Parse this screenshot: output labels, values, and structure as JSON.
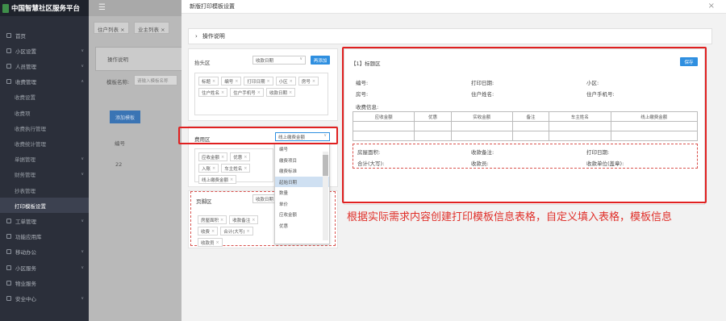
{
  "sidebar": {
    "title": "中国智慧社区服务平台",
    "items": [
      {
        "label": "首页",
        "icon": "home-icon",
        "chevron": ""
      },
      {
        "label": "小区设置",
        "icon": "building-icon",
        "chevron": "∨"
      },
      {
        "label": "人员管理",
        "icon": "users-icon",
        "chevron": "∨"
      },
      {
        "label": "收费管理",
        "icon": "money-icon",
        "chevron": "∧"
      },
      {
        "label": "收费设置",
        "sub": true
      },
      {
        "label": "收费项",
        "sub": true
      },
      {
        "label": "收费执行管理",
        "sub": true
      },
      {
        "label": "收费统计管理",
        "sub": true
      },
      {
        "label": "单据管理",
        "sub": true,
        "chevron": "∨"
      },
      {
        "label": "财务管理",
        "sub": true,
        "chevron": "∨"
      },
      {
        "label": "抄表管理",
        "sub": true
      },
      {
        "label": "打印模板设置",
        "sub": true,
        "active": true
      },
      {
        "label": "工单管理",
        "icon": "ticket-icon",
        "chevron": "∨"
      },
      {
        "label": "功能应用库",
        "icon": "grid-icon",
        "chevron": ""
      },
      {
        "label": "移动办公",
        "icon": "mobile-icon",
        "chevron": "∨"
      },
      {
        "label": "小区服务",
        "icon": "service-icon",
        "chevron": "∨"
      },
      {
        "label": "物业服务",
        "icon": "house-icon",
        "chevron": ""
      },
      {
        "label": "安全中心",
        "icon": "shield-icon",
        "chevron": "∨"
      }
    ]
  },
  "page": {
    "menu_glyph": "☰",
    "tabs": [
      "住户列表 ×",
      "业主列表 ×"
    ],
    "op_label": "操作说明",
    "search_label": "模板名称:",
    "search_placeholder": "请输入模板名称",
    "add_button": "添加模板",
    "col_header": "编号",
    "row_value": "22"
  },
  "modal": {
    "title": "新版打印模板设置",
    "close": "×",
    "op_row": "操作说明",
    "head_zone": {
      "label": "抬头区",
      "select": "收款日期",
      "button": "再添加",
      "tags": [
        "标题",
        "编号",
        "打印日期",
        "小区",
        "房号",
        "住户姓名",
        "住户手机号",
        "收款日期"
      ]
    },
    "detail_zone": {
      "label": "费用区",
      "select": "线上缴费金额",
      "tags": [
        "应收金额",
        "优惠",
        "入账",
        "车主姓名",
        "线上缴费金额"
      ],
      "dropdown": [
        "编号",
        "缴费项目",
        "缴费标准",
        "起始日期",
        "数量",
        "单价",
        "应收金额",
        "优惠"
      ],
      "dropdown_highlight": 3
    },
    "foot_zone": {
      "label": "页脚区",
      "select": "收款日期",
      "tags": [
        "房屋面积",
        "收款备注",
        "收费",
        "合计(大写)",
        "收款员"
      ]
    },
    "preview": {
      "title": "【1】标题区",
      "save": "保存",
      "row1": [
        "编号:",
        "打印日期:",
        "小区:"
      ],
      "row2": [
        "房号:",
        "住户姓名:",
        "住户手机号:"
      ],
      "table_label": "收费信息:",
      "columns": [
        "应收金额",
        "优惠",
        "实收金额",
        "备注",
        "车主姓名",
        "线上缴费金额"
      ],
      "footer1": [
        "房屋面积:",
        "收款备注:",
        "打印日期:"
      ],
      "footer2": [
        "合计(大写):",
        "收款员:",
        "收款单位(盖章):"
      ]
    },
    "note": "根据实际需求内容创建打印模板信息表格，自定义填入表格，模板信息"
  },
  "colors": {
    "accent": "#2f8fe0",
    "highlight": "#e02020",
    "sidebar": "#2b2f3a"
  }
}
